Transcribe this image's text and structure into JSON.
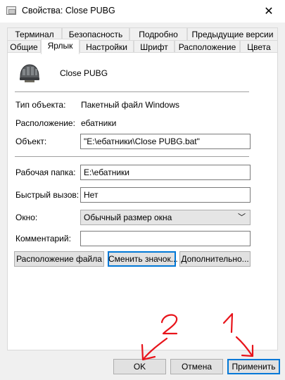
{
  "window": {
    "title": "Свойства: Close PUBG",
    "close_glyph": "✕"
  },
  "tabs_row1": [
    "Терминал",
    "Безопасность",
    "Подробно",
    "Предыдущие версии"
  ],
  "tabs_row2": [
    "Общие",
    "Ярлык",
    "Настройки",
    "Шрифт",
    "Расположение",
    "Цвета"
  ],
  "shortcut": {
    "name": "Close PUBG",
    "type_label": "Тип объекта:",
    "type_value": "Пакетный файл Windows",
    "location_label": "Расположение:",
    "location_value": "ебатники",
    "target_label": "Объект:",
    "target_value": "\"E:\\ебатники\\Close PUBG.bat\"",
    "start_in_label": "Рабочая папка:",
    "start_in_value": "E:\\ебатники",
    "hotkey_label": "Быстрый вызов:",
    "hotkey_value": "Нет",
    "run_label": "Окно:",
    "run_value": "Обычный размер окна",
    "comment_label": "Комментарий:",
    "comment_value": ""
  },
  "buttons": {
    "open_location": "Расположение файла",
    "change_icon": "Сменить значок...",
    "advanced": "Дополнительно...",
    "ok": "OK",
    "cancel": "Отмена",
    "apply": "Применить"
  },
  "annotations": {
    "mark_ok": "2",
    "mark_apply": "1",
    "ink_color": "#e8141b"
  },
  "colors": {
    "focus": "#0078d7",
    "dialog_bg": "#f0f0f0",
    "button_bg": "#e1e1e1"
  }
}
